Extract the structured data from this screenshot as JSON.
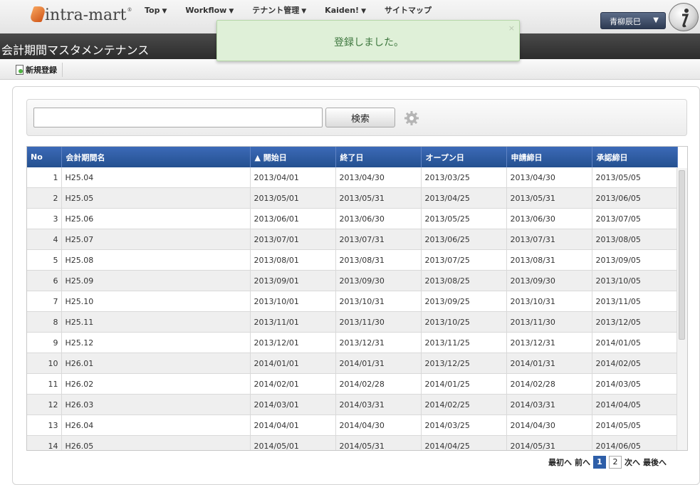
{
  "header": {
    "logo_text": "intra-mart",
    "nav": [
      "Top",
      "Workflow",
      "テナント管理",
      "Kaiden!",
      "サイトマップ"
    ],
    "user_name": "青柳辰巳"
  },
  "page": {
    "title": "会計期間マスタメンテナンス",
    "new_button": "新規登録"
  },
  "toast": {
    "message": "登録しました。",
    "close": "×"
  },
  "search": {
    "value": "",
    "button": "検索"
  },
  "table": {
    "columns": [
      "No",
      "会計期間名",
      "▲ 開始日",
      "終了日",
      "オープン日",
      "申請締日",
      "承認締日"
    ],
    "rows": [
      [
        "1",
        "H25.04",
        "2013/04/01",
        "2013/04/30",
        "2013/03/25",
        "2013/04/30",
        "2013/05/05"
      ],
      [
        "2",
        "H25.05",
        "2013/05/01",
        "2013/05/31",
        "2013/04/25",
        "2013/05/31",
        "2013/06/05"
      ],
      [
        "3",
        "H25.06",
        "2013/06/01",
        "2013/06/30",
        "2013/05/25",
        "2013/06/30",
        "2013/07/05"
      ],
      [
        "4",
        "H25.07",
        "2013/07/01",
        "2013/07/31",
        "2013/06/25",
        "2013/07/31",
        "2013/08/05"
      ],
      [
        "5",
        "H25.08",
        "2013/08/01",
        "2013/08/31",
        "2013/07/25",
        "2013/08/31",
        "2013/09/05"
      ],
      [
        "6",
        "H25.09",
        "2013/09/01",
        "2013/09/30",
        "2013/08/25",
        "2013/09/30",
        "2013/10/05"
      ],
      [
        "7",
        "H25.10",
        "2013/10/01",
        "2013/10/31",
        "2013/09/25",
        "2013/10/31",
        "2013/11/05"
      ],
      [
        "8",
        "H25.11",
        "2013/11/01",
        "2013/11/30",
        "2013/10/25",
        "2013/11/30",
        "2013/12/05"
      ],
      [
        "9",
        "H25.12",
        "2013/12/01",
        "2013/12/31",
        "2013/11/25",
        "2013/12/31",
        "2014/01/05"
      ],
      [
        "10",
        "H26.01",
        "2014/01/01",
        "2014/01/31",
        "2013/12/25",
        "2014/01/31",
        "2014/02/05"
      ],
      [
        "11",
        "H26.02",
        "2014/02/01",
        "2014/02/28",
        "2014/01/25",
        "2014/02/28",
        "2014/03/05"
      ],
      [
        "12",
        "H26.03",
        "2014/03/01",
        "2014/03/31",
        "2014/02/25",
        "2014/03/31",
        "2014/04/05"
      ],
      [
        "13",
        "H26.04",
        "2014/04/01",
        "2014/04/30",
        "2014/03/25",
        "2014/04/30",
        "2014/05/05"
      ],
      [
        "14",
        "H26.05",
        "2014/05/01",
        "2014/05/31",
        "2014/04/25",
        "2014/05/31",
        "2014/06/05"
      ]
    ]
  },
  "pager": {
    "first": "最初へ",
    "prev": "前へ",
    "pages": [
      "1",
      "2"
    ],
    "current": "1",
    "next": "次へ",
    "last": "最後へ"
  },
  "colors": {
    "header_blue": "#2e5ea8",
    "toast_bg": "#dff0d8",
    "toast_text": "#3c763d"
  }
}
